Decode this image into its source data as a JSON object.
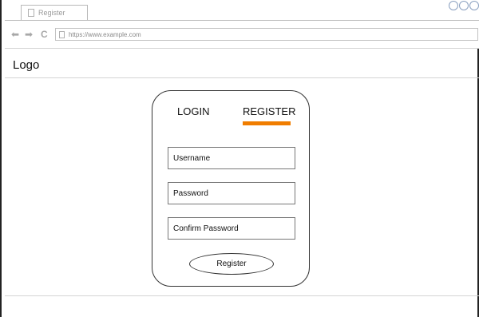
{
  "browser": {
    "tab_title": "Register",
    "url": "https://www.example.com",
    "icons": {
      "back": "back-arrow-icon",
      "forward": "forward-arrow-icon",
      "reload": "reload-icon",
      "page": "page-icon"
    }
  },
  "header": {
    "logo": "Logo"
  },
  "auth": {
    "tabs": {
      "login": "LOGIN",
      "register": "REGISTER",
      "active": "register",
      "accent_color": "#f07d00"
    },
    "fields": {
      "username": "Username",
      "password": "Password",
      "confirm_password": "Confirm Password"
    },
    "submit_label": "Register"
  }
}
